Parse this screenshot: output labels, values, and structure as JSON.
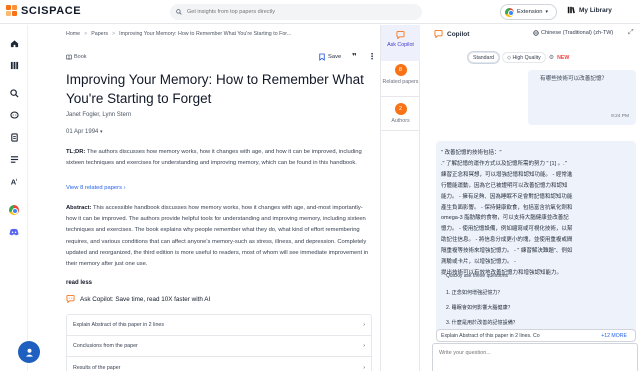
{
  "brand": {
    "name": "SCISPACE"
  },
  "search": {
    "placeholder": "Get insights from top papers directly"
  },
  "header": {
    "extension_label": "Extension",
    "library_label": "My Library"
  },
  "breadcrumb": [
    "Home",
    "Papers",
    "Improving Your Memory: How to Remember What You're Starting to For..."
  ],
  "paper": {
    "type": "Book",
    "save_label": "Save",
    "title": "Improving Your Memory: How to Remember What You're Starting to Forget",
    "authors": "Janet Fogler, Lynn Stern",
    "date": "01 Apr 1994",
    "tldr_label": "TL;DR:",
    "tldr": "The authors discusses how memory works, how it changes with age, and how it can be improved, including sixteen techniques and exercises for understanding and improving memory, which can be found in this handbook.",
    "related_label": "View 8 related papers",
    "abstract_label": "Abstract:",
    "abstract": "This accessible handbook discusses how memory works, how it changes with age, and-most importantly-how it can be improved. The authors provide helpful tools for understanding and improving memory, including sixteen techniques and exercises. The book explains why people remember what they do, what kind of effort remembering requires, and various conditions that can affect anyone's memory-such as stress, illness, and depression. Completely updated and reorganized, the third edition is more useful to readers, most of whom will see immediate improvement in their memory after just one use.",
    "read_less": "read less",
    "copilot_cta": "Ask Copilot: Save time, read 10X faster with AI",
    "questions": [
      "Explain Abstract of this paper in 2 lines",
      "Conclusions from the paper",
      "Results of the paper"
    ]
  },
  "side_tabs": [
    {
      "label": "Ask Copilot",
      "count": ""
    },
    {
      "label": "Related papers",
      "count": "8"
    },
    {
      "label": "Authors",
      "count": "2"
    }
  ],
  "copilot": {
    "title": "Copilot",
    "language": "Chinese (Traditional) (zh-TW)",
    "modes": [
      "Standard",
      "High Quality"
    ],
    "new_badge": "NEW",
    "user_message": "有哪些技術可以改善記憶？",
    "user_time": "9:24 PM",
    "ai_lines": [
      "\" 改善記憶的技術包括：\"",
      ".\" 了解記憶的運作方式以及記憶所需的努力 \" [1] 。.\"",
      "練習正念和冥想，可以增強記憶和認知功能。 - 經常進",
      "行體能運動，因為它已被證明可以改善記憶力和認知",
      "能力。 - 擁有足夠、因為睡眠不足會對記憶和認知功能",
      "產生負面影響。 - 保持健康飲食，包括富含抗氧化劑和",
      "omega-3 脂肪酸的食物，可以支持大腦健康並改善記",
      "憶力。 - 使用記憶設備，例如縮寫或可視化技術，以幫",
      "助記住信息。 - 將信息分成更小的塊，並使用重複或間",
      "隔重複等技術來增強記憶力。 - \" 練習解決難題\"、例如",
      "測驗或卡片，以增強記憶力。 -",
      "提出技術可以有效地改善記憶力和增強認知能力。"
    ],
    "quick_label": "Quickly ask these questions",
    "quick_questions": [
      "1. 正念如何增強記憶力？",
      "2. 睡眠會如何影響大腦健康？",
      "3. 什麼是用於改善的記憶設備？"
    ],
    "suggestion": "Explain Abstract of this paper in 2 lines. Co",
    "suggestion_more": "+12 MORE",
    "input_placeholder": "Write your question..."
  },
  "colors": {
    "accent": "#f97316",
    "primary": "#1e5fbf",
    "link": "#2563eb",
    "tab_active": "#4338ca"
  }
}
